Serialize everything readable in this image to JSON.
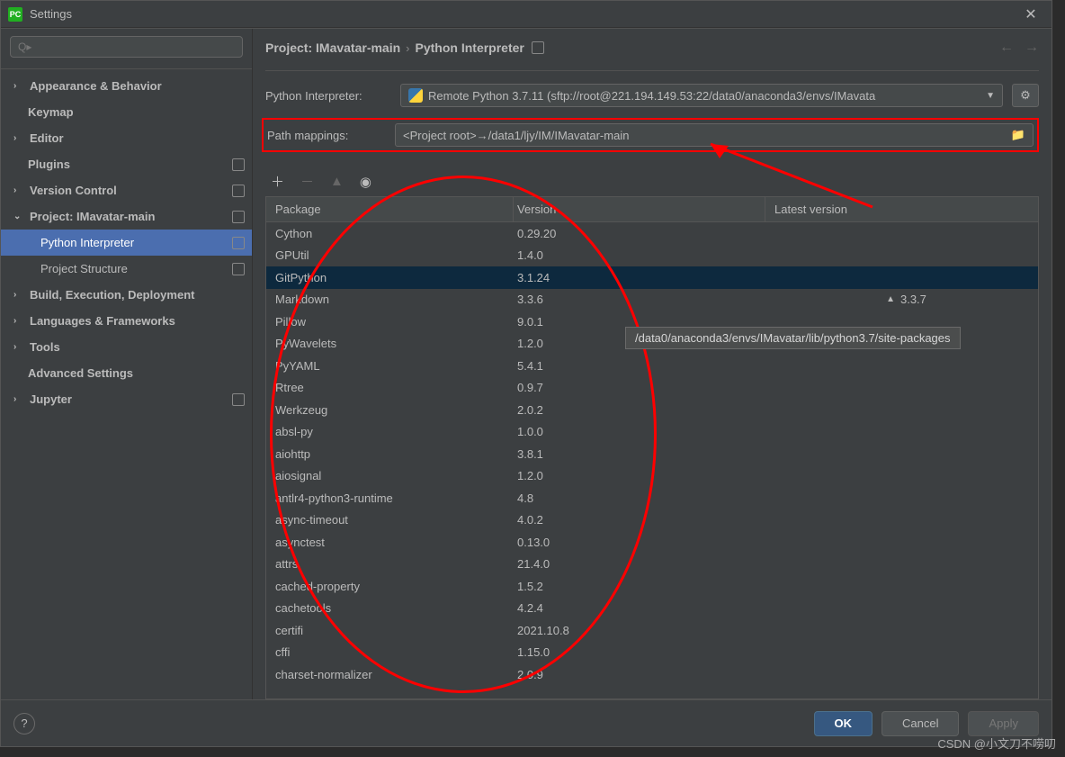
{
  "window": {
    "title": "Settings"
  },
  "search": {
    "placeholder": "Q▸"
  },
  "sidebar": {
    "items": [
      {
        "label": "Appearance & Behavior",
        "arrow": "›",
        "bold": true
      },
      {
        "label": "Keymap",
        "arrow": "",
        "bold": true,
        "noarrow": true
      },
      {
        "label": "Editor",
        "arrow": "›",
        "bold": true
      },
      {
        "label": "Plugins",
        "arrow": "",
        "bold": true,
        "noarrow": true,
        "badge": true
      },
      {
        "label": "Version Control",
        "arrow": "›",
        "bold": true,
        "badge": true
      },
      {
        "label": "Project: IMavatar-main",
        "arrow": "⌄",
        "bold": true,
        "badge": true
      },
      {
        "label": "Python Interpreter",
        "child": true,
        "selected": true,
        "badge": true
      },
      {
        "label": "Project Structure",
        "child": true,
        "badge": true
      },
      {
        "label": "Build, Execution, Deployment",
        "arrow": "›",
        "bold": true
      },
      {
        "label": "Languages & Frameworks",
        "arrow": "›",
        "bold": true
      },
      {
        "label": "Tools",
        "arrow": "›",
        "bold": true
      },
      {
        "label": "Advanced Settings",
        "arrow": "",
        "bold": true,
        "noarrow": true
      },
      {
        "label": "Jupyter",
        "arrow": "›",
        "bold": true,
        "badge": true
      }
    ]
  },
  "breadcrumb": {
    "root": "Project: IMavatar-main",
    "sep": "›",
    "leaf": "Python Interpreter"
  },
  "interpreter": {
    "label": "Python Interpreter:",
    "value": "Remote Python 3.7.11 (sftp://root@221.194.149.53:22/data0/anaconda3/envs/IMavata"
  },
  "path_mappings": {
    "label": "Path mappings:",
    "value": "<Project root>→/data1/ljy/IM/IMavatar-main"
  },
  "table": {
    "headers": {
      "pkg": "Package",
      "ver": "Version",
      "lat": "Latest version"
    },
    "rows": [
      {
        "pkg": "Cython",
        "ver": "0.29.20"
      },
      {
        "pkg": "GPUtil",
        "ver": "1.4.0"
      },
      {
        "pkg": "GitPython",
        "ver": "3.1.24",
        "sel": true
      },
      {
        "pkg": "Markdown",
        "ver": "3.3.6",
        "lat": "3.3.7",
        "up": true
      },
      {
        "pkg": "Pillow",
        "ver": "9.0.1"
      },
      {
        "pkg": "PyWavelets",
        "ver": "1.2.0"
      },
      {
        "pkg": "PyYAML",
        "ver": "5.4.1"
      },
      {
        "pkg": "Rtree",
        "ver": "0.9.7"
      },
      {
        "pkg": "Werkzeug",
        "ver": "2.0.2"
      },
      {
        "pkg": "absl-py",
        "ver": "1.0.0"
      },
      {
        "pkg": "aiohttp",
        "ver": "3.8.1"
      },
      {
        "pkg": "aiosignal",
        "ver": "1.2.0"
      },
      {
        "pkg": "antlr4-python3-runtime",
        "ver": "4.8"
      },
      {
        "pkg": "async-timeout",
        "ver": "4.0.2"
      },
      {
        "pkg": "asynctest",
        "ver": "0.13.0"
      },
      {
        "pkg": "attrs",
        "ver": "21.4.0"
      },
      {
        "pkg": "cached-property",
        "ver": "1.5.2"
      },
      {
        "pkg": "cachetools",
        "ver": "4.2.4"
      },
      {
        "pkg": "certifi",
        "ver": "2021.10.8"
      },
      {
        "pkg": "cffi",
        "ver": "1.15.0"
      },
      {
        "pkg": "charset-normalizer",
        "ver": "2.0.9"
      }
    ]
  },
  "tooltip": "/data0/anaconda3/envs/IMavatar/lib/python3.7/site-packages",
  "footer": {
    "ok": "OK",
    "cancel": "Cancel",
    "apply": "Apply"
  },
  "watermark": "CSDN @小文刀不唠叨"
}
